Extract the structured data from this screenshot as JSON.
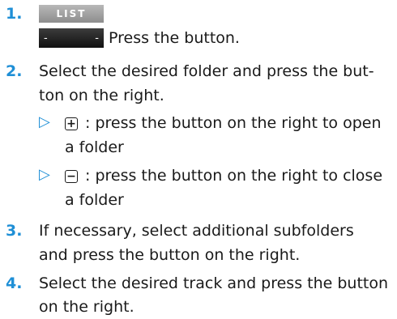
{
  "steps": [
    {
      "num": "1.",
      "button_list": "LIST",
      "button_left": "-",
      "button_right": "-",
      "lines": [
        "Press the button."
      ]
    },
    {
      "num": "2.",
      "lines": [
        "Select the desired folder and press the but-",
        "ton on the right."
      ]
    },
    {
      "num": "3.",
      "lines": [
        "If necessary, select additional subfolders",
        "and press the button on the right."
      ]
    },
    {
      "num": "4.",
      "lines": [
        "Select the desired track and press the button",
        "on the right."
      ]
    }
  ],
  "bullets": [
    {
      "marker": "▷",
      "icon": "plus-box-icon",
      "icon_glyph": "+",
      "lines": [
        ": press the button on the right to open",
        "a folder"
      ]
    },
    {
      "marker": "▷",
      "icon": "minus-box-icon",
      "icon_glyph": "−",
      "lines": [
        ": press the button on the right to close",
        "a folder"
      ]
    }
  ]
}
